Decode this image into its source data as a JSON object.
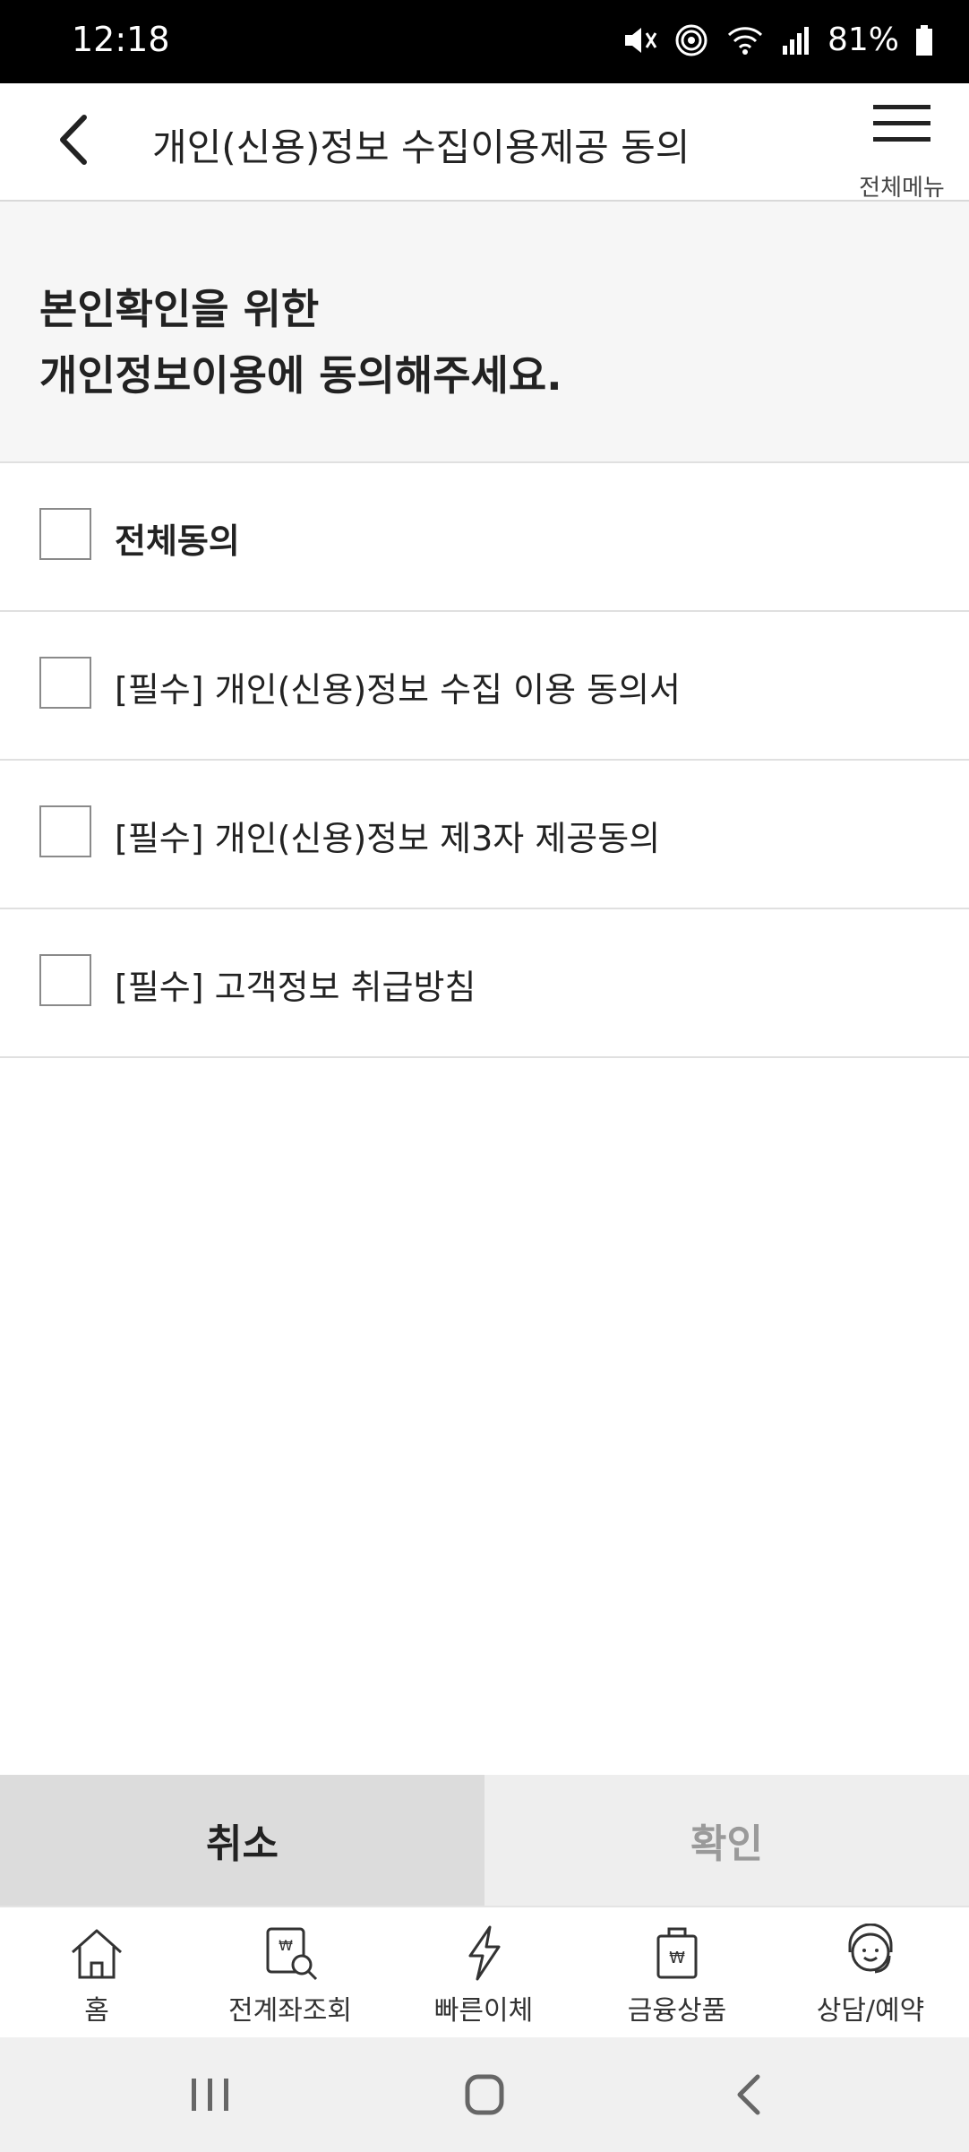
{
  "status_bar": {
    "time": "12:18",
    "battery": "81%"
  },
  "header": {
    "title": "개인(신용)정보 수집이용제공 동의",
    "menu_label": "전체메뉴"
  },
  "intro": {
    "line1": "본인확인을 위한",
    "line2": "개인정보이용에 동의해주세요."
  },
  "agreements": [
    {
      "label": "전체동의",
      "checked": false
    },
    {
      "label": "[필수] 개인(신용)정보 수집 이용 동의서",
      "checked": false
    },
    {
      "label": "[필수] 개인(신용)정보 제3자 제공동의",
      "checked": false
    },
    {
      "label": "[필수] 고객정보 취급방침",
      "checked": false
    }
  ],
  "buttons": {
    "cancel": "취소",
    "confirm": "확인"
  },
  "bottom_nav": [
    {
      "label": "홈",
      "icon": "home-icon"
    },
    {
      "label": "전계좌조회",
      "icon": "account-search-icon"
    },
    {
      "label": "빠른이체",
      "icon": "lightning-icon"
    },
    {
      "label": "금융상품",
      "icon": "shopping-bag-won-icon"
    },
    {
      "label": "상담/예약",
      "icon": "headset-agent-icon"
    }
  ]
}
